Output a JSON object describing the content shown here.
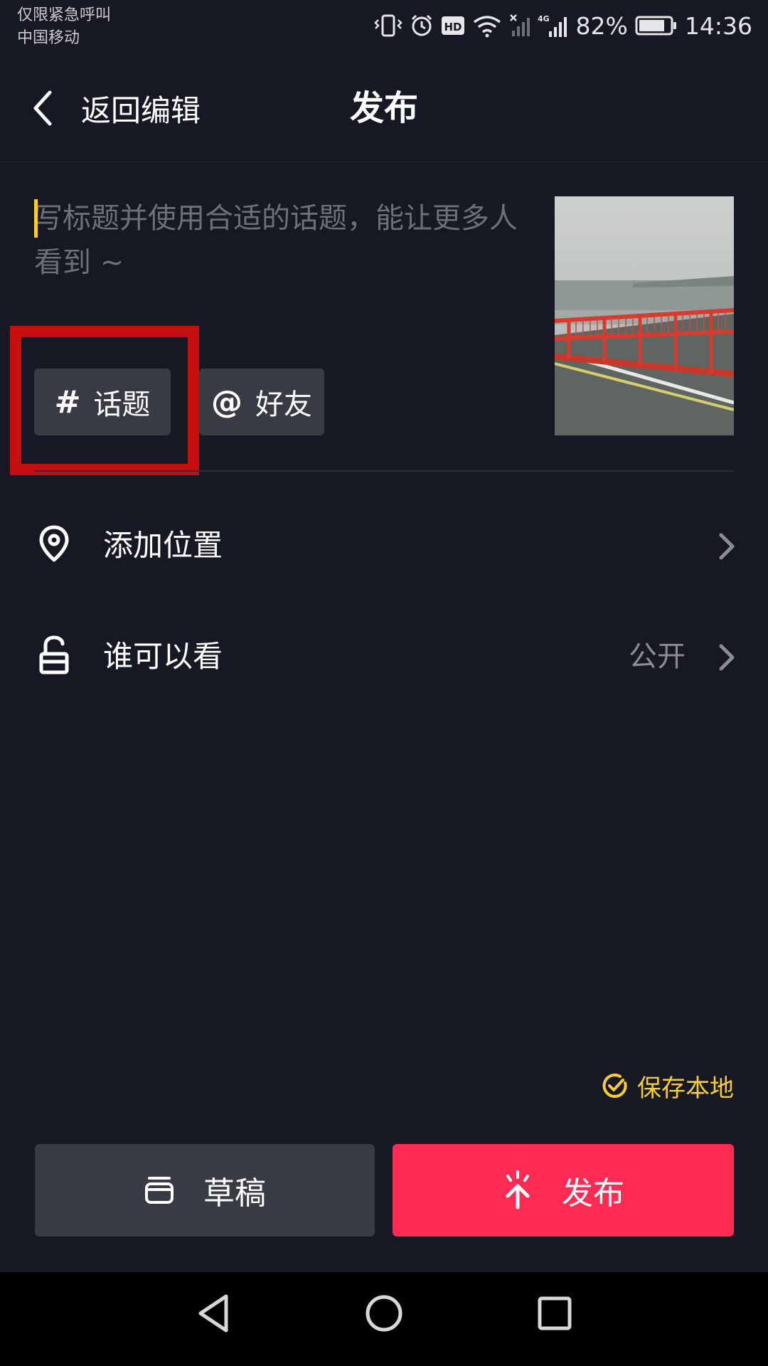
{
  "status_bar": {
    "carrier_line1": "仅限紧急呼叫",
    "carrier_line2": "中国移动",
    "network": "4G",
    "battery": "82%",
    "time": "14:36",
    "icons": [
      "vibrate-icon",
      "alarm-icon",
      "hd-icon",
      "wifi-icon",
      "no-signal-icon",
      "signal-icon",
      "battery-icon"
    ]
  },
  "header": {
    "back_label": "返回编辑",
    "title": "发布"
  },
  "caption": {
    "placeholder": "写标题并使用合适的话题，能让更多人看到 ~"
  },
  "tags": {
    "topic_symbol": "#",
    "topic_label": "话题",
    "friend_symbol": "@",
    "friend_label": "好友"
  },
  "rows": {
    "location_label": "添加位置",
    "privacy_label": "谁可以看",
    "privacy_value": "公开"
  },
  "save_local": {
    "label": "保存本地",
    "checked": true
  },
  "buttons": {
    "draft_label": "草稿",
    "publish_label": "发布"
  },
  "colors": {
    "background": "#161823",
    "accent_red": "#fe2c55",
    "accent_yellow": "#facd2e",
    "highlight_red": "#c50f0f"
  }
}
